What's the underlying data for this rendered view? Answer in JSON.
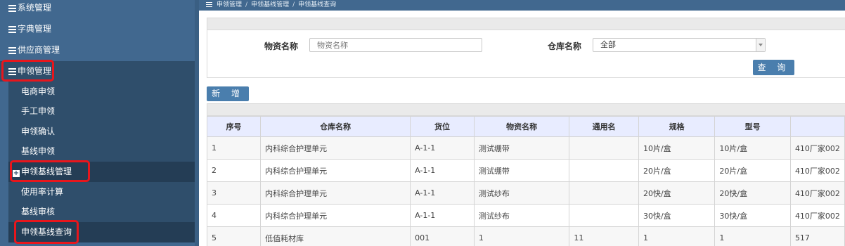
{
  "breadcrumb": {
    "items": [
      "申领管理",
      "申领基线管理",
      "申领基线查询"
    ]
  },
  "sidebar": {
    "top_items": [
      {
        "label": "系统管理"
      },
      {
        "label": "字典管理"
      },
      {
        "label": "供应商管理"
      },
      {
        "label": "申领管理"
      }
    ],
    "sub_items": [
      {
        "label": "电商申领"
      },
      {
        "label": "手工申领"
      },
      {
        "label": "申领确认"
      },
      {
        "label": "基线申领"
      },
      {
        "label": "申领基线管理"
      },
      {
        "label": "使用率计算"
      },
      {
        "label": "基线审核"
      },
      {
        "label": "申领基线查询"
      }
    ]
  },
  "search": {
    "material_label": "物资名称",
    "material_placeholder": "物资名称",
    "warehouse_label": "仓库名称",
    "warehouse_value": "全部",
    "query_button": "查 询"
  },
  "toolbar": {
    "add_button": "新 增"
  },
  "table": {
    "columns": [
      "序号",
      "仓库名称",
      "货位",
      "物资名称",
      "通用名",
      "规格",
      "型号",
      ""
    ],
    "rows": [
      [
        "1",
        "内科综合护理单元",
        "A-1-1",
        "测试绷带",
        "",
        "10片/盒",
        "10片/盒",
        "410厂家002"
      ],
      [
        "2",
        "内科综合护理单元",
        "A-1-1",
        "测试绷带",
        "",
        "20片/盒",
        "20片/盒",
        "410厂家002"
      ],
      [
        "3",
        "内科综合护理单元",
        "A-1-1",
        "测试纱布",
        "",
        "20快/盒",
        "20快/盒",
        "410厂家002"
      ],
      [
        "4",
        "内科综合护理单元",
        "A-1-1",
        "测试纱布",
        "",
        "30快/盒",
        "30快/盒",
        "410厂家002"
      ],
      [
        "5",
        "低值耗材库",
        "001",
        "1",
        "11",
        "1",
        "1",
        "517"
      ]
    ]
  },
  "colors": {
    "sidebar_bg": "#41688f",
    "sidebar_active": "#2f4e6b",
    "button_bg": "#4a7ead",
    "highlight": "#e8161c",
    "table_header": "#e8ecff"
  }
}
